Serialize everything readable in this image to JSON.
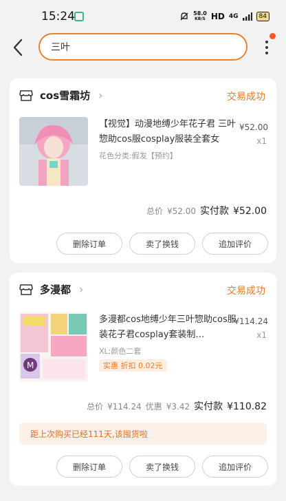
{
  "status_bar": {
    "time": "15:24",
    "net_speed_value": "58.0",
    "net_speed_unit": "KB/S",
    "hd_label": "HD",
    "signal_label": "4G",
    "battery": "84"
  },
  "search": {
    "query": "三叶"
  },
  "orders": [
    {
      "shop_name": "cos雪霜坊",
      "trade_status": "交易成功",
      "title": "【视觉】动漫地缚少年花子君 三叶惣助cos服cosplay服装全套女",
      "sku": "花色分类:假发【预约】",
      "price": "¥52.00",
      "qty": "x1",
      "total_label": "总价",
      "total_value": "¥52.00",
      "paid_label": "实付款",
      "paid_value": "¥52.00",
      "actions": [
        "删除订单",
        "卖了换钱",
        "追加评价"
      ]
    },
    {
      "shop_name": "多漫都",
      "trade_status": "交易成功",
      "title": "多漫都cos地缚少年三叶惣助cos服装花子君cosplay套装制…",
      "sku": "XL;颜色二套",
      "promo": "实惠 折扣 0.02元",
      "price": "¥114.24",
      "qty": "x1",
      "total_label": "总价",
      "total_value": "¥114.24",
      "discount_label": "优惠",
      "discount_value": "¥3.42",
      "paid_label": "实付款",
      "paid_value": "¥110.82",
      "notice": "距上次购买已经111天,该囤货啦",
      "actions": [
        "删除订单",
        "卖了换钱",
        "追加评价"
      ]
    }
  ],
  "colors": {
    "accent": "#e8802c",
    "status_text": "#e37c2c",
    "notice_bg": "#fdf0e6"
  }
}
